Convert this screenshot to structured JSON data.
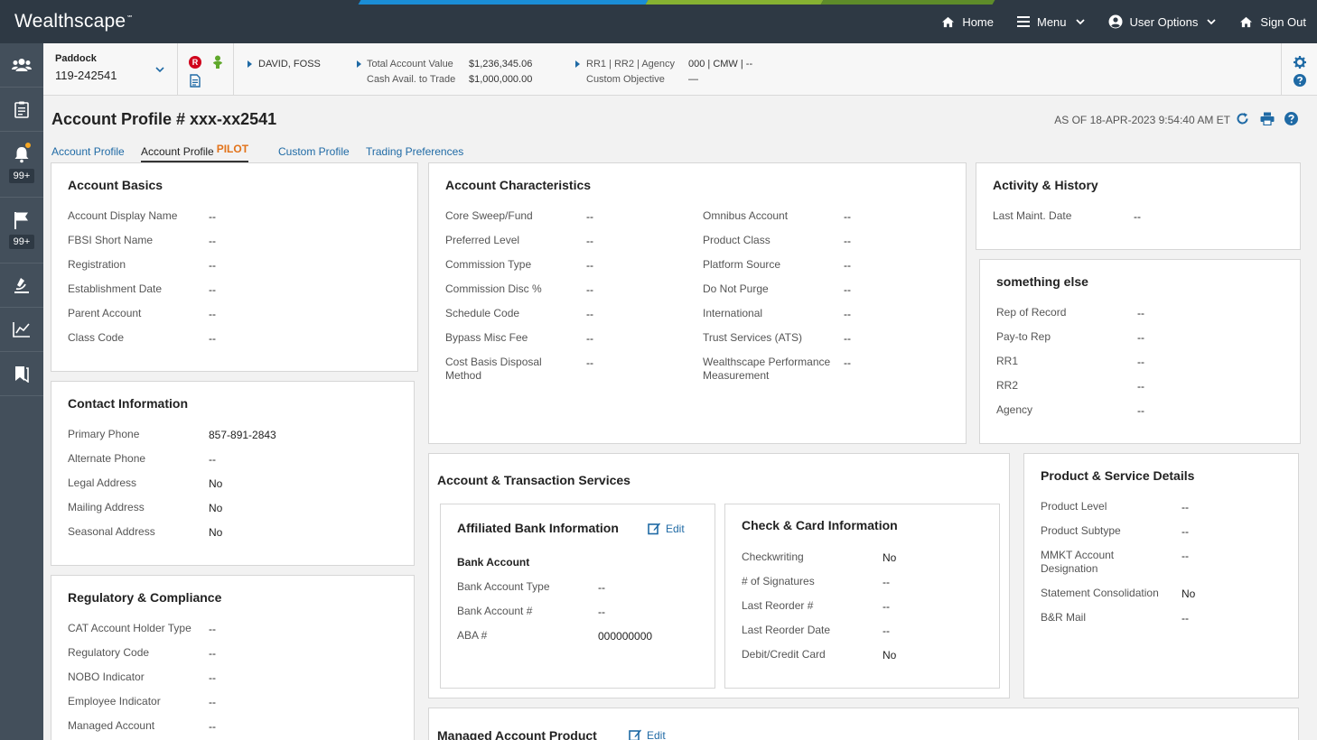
{
  "header": {
    "brand": "Wealthscape",
    "brand_mark": "℠",
    "nav": {
      "home": "Home",
      "menu": "Menu",
      "user_options": "User Options",
      "sign_out": "Sign Out"
    }
  },
  "rail": {
    "notifications_badge": "99+",
    "flags_badge": "99+"
  },
  "account_bar": {
    "account_name": "Paddock",
    "account_number": "119-242541",
    "client_name": "DAVID, FOSS",
    "total_value_label": "Total Account Value",
    "total_value": "$1,236,345.06",
    "cash_label": "Cash Avail. to Trade",
    "cash_value": "$1,000,000.00",
    "rr_label": "RR1 | RR2 | Agency",
    "rr_value": "000 | CMW | --",
    "objective_label": "Custom Objective",
    "objective_value": "—",
    "restriction_letter": "R"
  },
  "page": {
    "title": "Account Profile # xxx-xx2541",
    "as_of": "AS OF 18-APR-2023  9:54:40 AM ET"
  },
  "tabs": [
    {
      "label": "Account Profile"
    },
    {
      "label": "Account Profile",
      "tag": "PILOT"
    },
    {
      "label": "Custom Profile"
    },
    {
      "label": "Trading Preferences"
    }
  ],
  "account_basics": {
    "title": "Account Basics",
    "rows": [
      {
        "label": "Account Display Name",
        "value": "--"
      },
      {
        "label": "FBSI Short Name",
        "value": "--"
      },
      {
        "label": "Registration",
        "value": "--"
      },
      {
        "label": "Establishment Date",
        "value": "--"
      },
      {
        "label": "Parent Account",
        "value": "--"
      },
      {
        "label": "Class Code",
        "value": "--"
      }
    ]
  },
  "contact_info": {
    "title": "Contact Information",
    "rows": [
      {
        "label": "Primary Phone",
        "value": "857-891-2843"
      },
      {
        "label": "Alternate Phone",
        "value": "--"
      },
      {
        "label": "Legal Address",
        "value": "No"
      },
      {
        "label": "Mailing Address",
        "value": "No"
      },
      {
        "label": "Seasonal Address",
        "value": "No"
      }
    ]
  },
  "regulatory": {
    "title": "Regulatory & Compliance",
    "rows": [
      {
        "label": "CAT Account Holder Type",
        "value": "--"
      },
      {
        "label": "Regulatory Code",
        "value": "--"
      },
      {
        "label": "NOBO Indicator",
        "value": "--"
      },
      {
        "label": "Employee Indicator",
        "value": "--"
      },
      {
        "label": "Managed Account",
        "value": "--"
      }
    ]
  },
  "account_characteristics": {
    "title": "Account Characteristics",
    "left": [
      {
        "label": "Core Sweep/Fund",
        "value": "--"
      },
      {
        "label": "Preferred Level",
        "value": "--"
      },
      {
        "label": "Commission Type",
        "value": "--"
      },
      {
        "label": "Commission Disc %",
        "value": "--"
      },
      {
        "label": "Schedule Code",
        "value": "--"
      },
      {
        "label": "Bypass Misc Fee",
        "value": "--"
      },
      {
        "label": "Cost Basis Disposal Method",
        "value": "--"
      }
    ],
    "right": [
      {
        "label": "Omnibus Account",
        "value": "--"
      },
      {
        "label": "Product Class",
        "value": "--"
      },
      {
        "label": "Platform Source",
        "value": "--"
      },
      {
        "label": "Do Not Purge",
        "value": "--"
      },
      {
        "label": "International",
        "value": "--"
      },
      {
        "label": "Trust Services (ATS)",
        "value": "--"
      },
      {
        "label": "Wealthscape Performance Measurement",
        "value": "--"
      }
    ]
  },
  "activity_history": {
    "title": "Activity & History",
    "rows": [
      {
        "label": "Last Maint. Date",
        "value": "--"
      }
    ]
  },
  "something_else": {
    "title": "something else",
    "rows": [
      {
        "label": "Rep of Record",
        "value": "--"
      },
      {
        "label": "Pay-to Rep",
        "value": "--"
      },
      {
        "label": "RR1",
        "value": "--"
      },
      {
        "label": "RR2",
        "value": "--"
      },
      {
        "label": "Agency",
        "value": "--"
      }
    ]
  },
  "acct_txn_services": {
    "title": "Account & Transaction Services",
    "bank": {
      "title": "Affiliated Bank Information",
      "edit": "Edit",
      "subhead": "Bank Account",
      "rows": [
        {
          "label": "Bank Account Type",
          "value": "--"
        },
        {
          "label": "Bank Account #",
          "value": "--"
        },
        {
          "label": "ABA #",
          "value": "000000000"
        }
      ]
    },
    "check": {
      "title": "Check & Card Information",
      "rows": [
        {
          "label": "Checkwriting",
          "value": "No"
        },
        {
          "label": "# of Signatures",
          "value": "--"
        },
        {
          "label": "Last Reorder #",
          "value": "--"
        },
        {
          "label": "Last Reorder Date",
          "value": "--"
        },
        {
          "label": "Debit/Credit Card",
          "value": "No"
        }
      ]
    }
  },
  "product_service": {
    "title": "Product & Service Details",
    "rows": [
      {
        "label": "Product Level",
        "value": "--"
      },
      {
        "label": "Product Subtype",
        "value": "--"
      },
      {
        "label": "MMKT Account Designation",
        "value": "--"
      },
      {
        "label": "Statement Consolidation",
        "value": "No"
      },
      {
        "label": "B&R Mail",
        "value": "--"
      }
    ]
  },
  "managed_product": {
    "title": "Managed Account Product",
    "edit": "Edit"
  },
  "colors": {
    "link": "#1f6aa5",
    "header": "#2e3944",
    "rail": "#434f5b",
    "pilot": "#e2731a"
  }
}
